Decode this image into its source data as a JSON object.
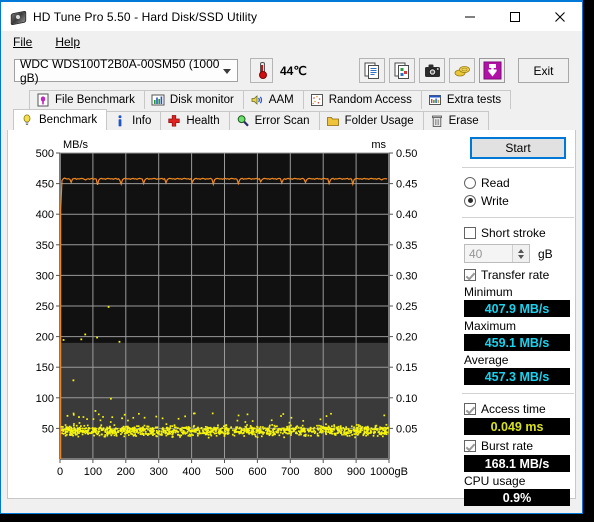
{
  "window": {
    "title": "HD Tune Pro 5.50 - Hard Disk/SSD Utility",
    "icon": "hard-disk-icon",
    "minimize": "—",
    "maximize": "☐",
    "close": "✕"
  },
  "menu": {
    "items": [
      {
        "label": "File"
      },
      {
        "label": "Help"
      }
    ]
  },
  "toolbar": {
    "drive": "WDC WDS100T2B0A-00SM50 (1000 gB)",
    "temperature": "44℃",
    "icons": [
      {
        "name": "copy-text-icon"
      },
      {
        "name": "copy-image-icon"
      },
      {
        "name": "screenshot-camera-icon"
      },
      {
        "name": "donate-coins-icon"
      },
      {
        "name": "download-arrow-icon"
      }
    ],
    "exit_label": "Exit"
  },
  "tabs": {
    "row1": [
      {
        "label": "File Benchmark",
        "icon": "file-benchmark-icon",
        "active": false
      },
      {
        "label": "Disk monitor",
        "icon": "disk-monitor-icon",
        "active": false
      },
      {
        "label": "AAM",
        "icon": "speaker-icon",
        "active": false
      },
      {
        "label": "Random Access",
        "icon": "random-access-icon",
        "active": false
      },
      {
        "label": "Extra tests",
        "icon": "extra-tests-icon",
        "active": false
      }
    ],
    "row2": [
      {
        "label": "Benchmark",
        "icon": "benchmark-bulb-icon",
        "active": true
      },
      {
        "label": "Info",
        "icon": "info-icon",
        "active": false
      },
      {
        "label": "Health",
        "icon": "health-cross-icon",
        "active": false
      },
      {
        "label": "Error Scan",
        "icon": "magnifier-icon",
        "active": false
      },
      {
        "label": "Folder Usage",
        "icon": "folder-icon",
        "active": false
      },
      {
        "label": "Erase",
        "icon": "trash-icon",
        "active": false
      }
    ]
  },
  "panel": {
    "start_label": "Start",
    "mode": {
      "read_label": "Read",
      "write_label": "Write",
      "read_selected": false,
      "write_selected": true
    },
    "short_stroke": {
      "label": "Short stroke",
      "checked": false,
      "value": "40",
      "unit": "gB"
    },
    "transfer_rate": {
      "label": "Transfer rate",
      "checked": true,
      "minimum_label": "Minimum",
      "minimum_value": "407.9 MB/s",
      "maximum_label": "Maximum",
      "maximum_value": "459.1 MB/s",
      "average_label": "Average",
      "average_value": "457.3 MB/s"
    },
    "access_time": {
      "label": "Access time",
      "checked": true,
      "value": "0.049 ms"
    },
    "burst_rate": {
      "label": "Burst rate",
      "checked": true,
      "value": "168.1 MB/s"
    },
    "cpu_usage": {
      "label": "CPU usage",
      "value": "0.9%"
    }
  },
  "chart_data": {
    "type": "line",
    "title": "",
    "xlabel": "gB",
    "ylabel": "MB/s",
    "y2label": "ms",
    "xlim": [
      0,
      1000
    ],
    "ylim": [
      0,
      500
    ],
    "y2lim": [
      0,
      0.5
    ],
    "grid": true,
    "legend_position": "none",
    "background": "#323232",
    "plot_fill": "#0d0d0d",
    "xticks": [
      0,
      100,
      200,
      300,
      400,
      500,
      600,
      700,
      800,
      900,
      1000
    ],
    "xticklabels": [
      "0",
      "100",
      "200",
      "300",
      "400",
      "500",
      "600",
      "700",
      "800",
      "900",
      "1000gB"
    ],
    "yticks": [
      50,
      100,
      150,
      200,
      250,
      300,
      350,
      400,
      450,
      500
    ],
    "yticklabels": [
      "50",
      "100",
      "150",
      "200",
      "250",
      "300",
      "350",
      "400",
      "450",
      "500"
    ],
    "y2ticks": [
      0.05,
      0.1,
      0.15,
      0.2,
      0.25,
      0.3,
      0.35,
      0.4,
      0.45,
      0.5
    ],
    "y2ticklabels": [
      "0.05",
      "0.10",
      "0.15",
      "0.20",
      "0.25",
      "0.30",
      "0.35",
      "0.40",
      "0.45",
      "0.50"
    ],
    "series": [
      {
        "name": "Transfer rate",
        "type": "line",
        "color": "#f08a20",
        "axis": "left",
        "unit": "MB/s",
        "x": [
          2,
          6,
          10,
          14,
          18,
          22,
          26,
          30,
          34,
          38,
          42,
          46,
          50,
          54,
          58,
          62,
          66,
          70,
          74,
          78,
          82,
          86,
          90,
          94,
          98,
          102,
          106,
          110,
          114,
          118,
          122,
          126,
          130,
          134,
          138,
          142,
          146,
          150,
          154,
          158,
          162,
          166,
          170,
          174,
          178,
          182,
          186,
          190,
          194,
          198,
          202,
          206,
          210,
          214,
          218,
          222,
          226,
          230,
          234,
          238,
          242,
          246,
          250,
          254,
          258,
          262,
          266,
          270,
          274,
          278,
          282,
          286,
          290,
          294,
          298,
          302,
          306,
          310,
          314,
          318,
          322,
          326,
          330,
          334,
          338,
          342,
          346,
          350,
          354,
          358,
          362,
          366,
          370,
          374,
          378,
          382,
          386,
          390,
          394,
          398,
          402,
          406,
          410,
          414,
          418,
          422,
          426,
          430,
          434,
          438,
          442,
          446,
          450,
          454,
          458,
          462,
          466,
          470,
          474,
          478,
          482,
          486,
          490,
          494,
          498,
          502,
          506,
          510,
          514,
          518,
          522,
          526,
          530,
          534,
          538,
          542,
          546,
          550,
          554,
          558,
          562,
          566,
          570,
          574,
          578,
          582,
          586,
          590,
          594,
          598,
          602,
          606,
          610,
          614,
          618,
          622,
          626,
          630,
          634,
          638,
          642,
          646,
          650,
          654,
          658,
          662,
          666,
          670,
          674,
          678,
          682,
          686,
          690,
          694,
          698,
          702,
          706,
          710,
          714,
          718,
          722,
          726,
          730,
          734,
          738,
          742,
          746,
          750,
          754,
          758,
          762,
          766,
          770,
          774,
          778,
          782,
          786,
          790,
          794,
          798,
          802,
          806,
          810,
          814,
          818,
          822,
          826,
          830,
          834,
          838,
          842,
          846,
          850,
          854,
          858,
          862,
          866,
          870,
          874,
          878,
          882,
          886,
          890,
          894,
          898,
          902,
          906,
          910,
          914,
          918,
          922,
          926,
          930,
          934,
          938,
          942,
          946,
          950,
          954,
          958,
          962,
          966,
          970,
          974,
          978,
          982,
          986,
          990,
          994,
          998
        ],
        "y": [
          407.9,
          455.0,
          458.0,
          459.1,
          458.0,
          457.5,
          458.0,
          457.0,
          452.0,
          457.5,
          458.0,
          458.5,
          457.0,
          458.0,
          457.5,
          458.0,
          458.5,
          458.0,
          457.0,
          456.0,
          457.5,
          458.0,
          457.0,
          458.0,
          458.5,
          457.0,
          458.0,
          457.5,
          448.0,
          456.0,
          458.0,
          458.5,
          457.5,
          458.0,
          457.0,
          458.0,
          458.5,
          458.0,
          457.5,
          458.0,
          457.0,
          458.0,
          458.5,
          457.0,
          458.0,
          455.0,
          449.0,
          456.5,
          458.0,
          458.5,
          458.0,
          457.5,
          458.0,
          457.0,
          458.0,
          458.5,
          457.5,
          458.0,
          457.0,
          458.0,
          458.5,
          458.0,
          457.5,
          450.0,
          456.0,
          458.0,
          458.5,
          457.0,
          458.0,
          457.5,
          458.0,
          458.5,
          458.0,
          457.0,
          458.0,
          457.5,
          458.0,
          458.5,
          457.0,
          458.0,
          451.0,
          456.5,
          458.0,
          458.5,
          458.0,
          457.5,
          458.0,
          457.0,
          458.0,
          458.5,
          457.5,
          458.0,
          457.0,
          458.0,
          458.5,
          458.0,
          457.5,
          458.0,
          457.0,
          458.0,
          452.0,
          456.0,
          458.0,
          458.5,
          457.5,
          458.0,
          457.0,
          458.0,
          458.5,
          458.0,
          457.0,
          458.0,
          457.5,
          458.0,
          458.5,
          457.0,
          449.0,
          456.5,
          458.0,
          458.5,
          458.0,
          457.5,
          458.0,
          457.0,
          458.0,
          458.5,
          457.5,
          458.0,
          457.0,
          458.0,
          458.5,
          458.0,
          457.5,
          458.0,
          457.0,
          450.0,
          456.0,
          458.0,
          458.5,
          457.0,
          458.0,
          457.5,
          458.0,
          458.5,
          458.0,
          457.0,
          458.0,
          457.5,
          458.0,
          458.5,
          457.0,
          458.0,
          453.0,
          456.5,
          458.0,
          458.5,
          458.0,
          457.5,
          458.0,
          457.0,
          458.0,
          458.5,
          457.5,
          458.0,
          457.0,
          458.0,
          458.5,
          458.0,
          451.0,
          456.0,
          458.0,
          457.0,
          458.0,
          458.5,
          457.5,
          458.0,
          457.0,
          458.0,
          458.5,
          458.0,
          457.5,
          458.0,
          457.0,
          458.0,
          458.5,
          457.0,
          452.0,
          456.5,
          458.0,
          458.5,
          458.0,
          457.5,
          458.0,
          457.0,
          458.0,
          458.5,
          457.5,
          458.0,
          457.0,
          458.0,
          458.5,
          458.0,
          457.5,
          458.0,
          450.0,
          456.0,
          458.0,
          458.5,
          457.0,
          458.0,
          457.5,
          458.0,
          458.5,
          458.0,
          457.0,
          458.0,
          457.5,
          458.0,
          458.5,
          457.0,
          458.0,
          457.5,
          449.0,
          456.5,
          458.0,
          458.5,
          458.0,
          457.5,
          458.0,
          457.0,
          458.0,
          458.5,
          457.5,
          458.0,
          457.0,
          458.0,
          458.5,
          458.0,
          457.5,
          458.0,
          457.0,
          458.0,
          458.5,
          457.0,
          456.0,
          457.5,
          458.0,
          458.0,
          457.5
        ]
      },
      {
        "name": "Access time",
        "type": "scatter",
        "color": "#f5f50a",
        "axis": "right",
        "unit": "ms",
        "average": 0.049,
        "cluster_range": [
          0.035,
          0.06
        ],
        "outliers": [
          {
            "x": 8,
            "y": 0.196
          },
          {
            "x": 38,
            "y": 0.13
          },
          {
            "x": 62,
            "y": 0.197
          },
          {
            "x": 74,
            "y": 0.205
          },
          {
            "x": 110,
            "y": 0.2
          },
          {
            "x": 145,
            "y": 0.25
          },
          {
            "x": 178,
            "y": 0.193
          },
          {
            "x": 152,
            "y": 0.1
          },
          {
            "x": 105,
            "y": 0.08
          },
          {
            "x": 20,
            "y": 0.072
          },
          {
            "x": 55,
            "y": 0.07
          },
          {
            "x": 186,
            "y": 0.068
          }
        ]
      }
    ]
  }
}
